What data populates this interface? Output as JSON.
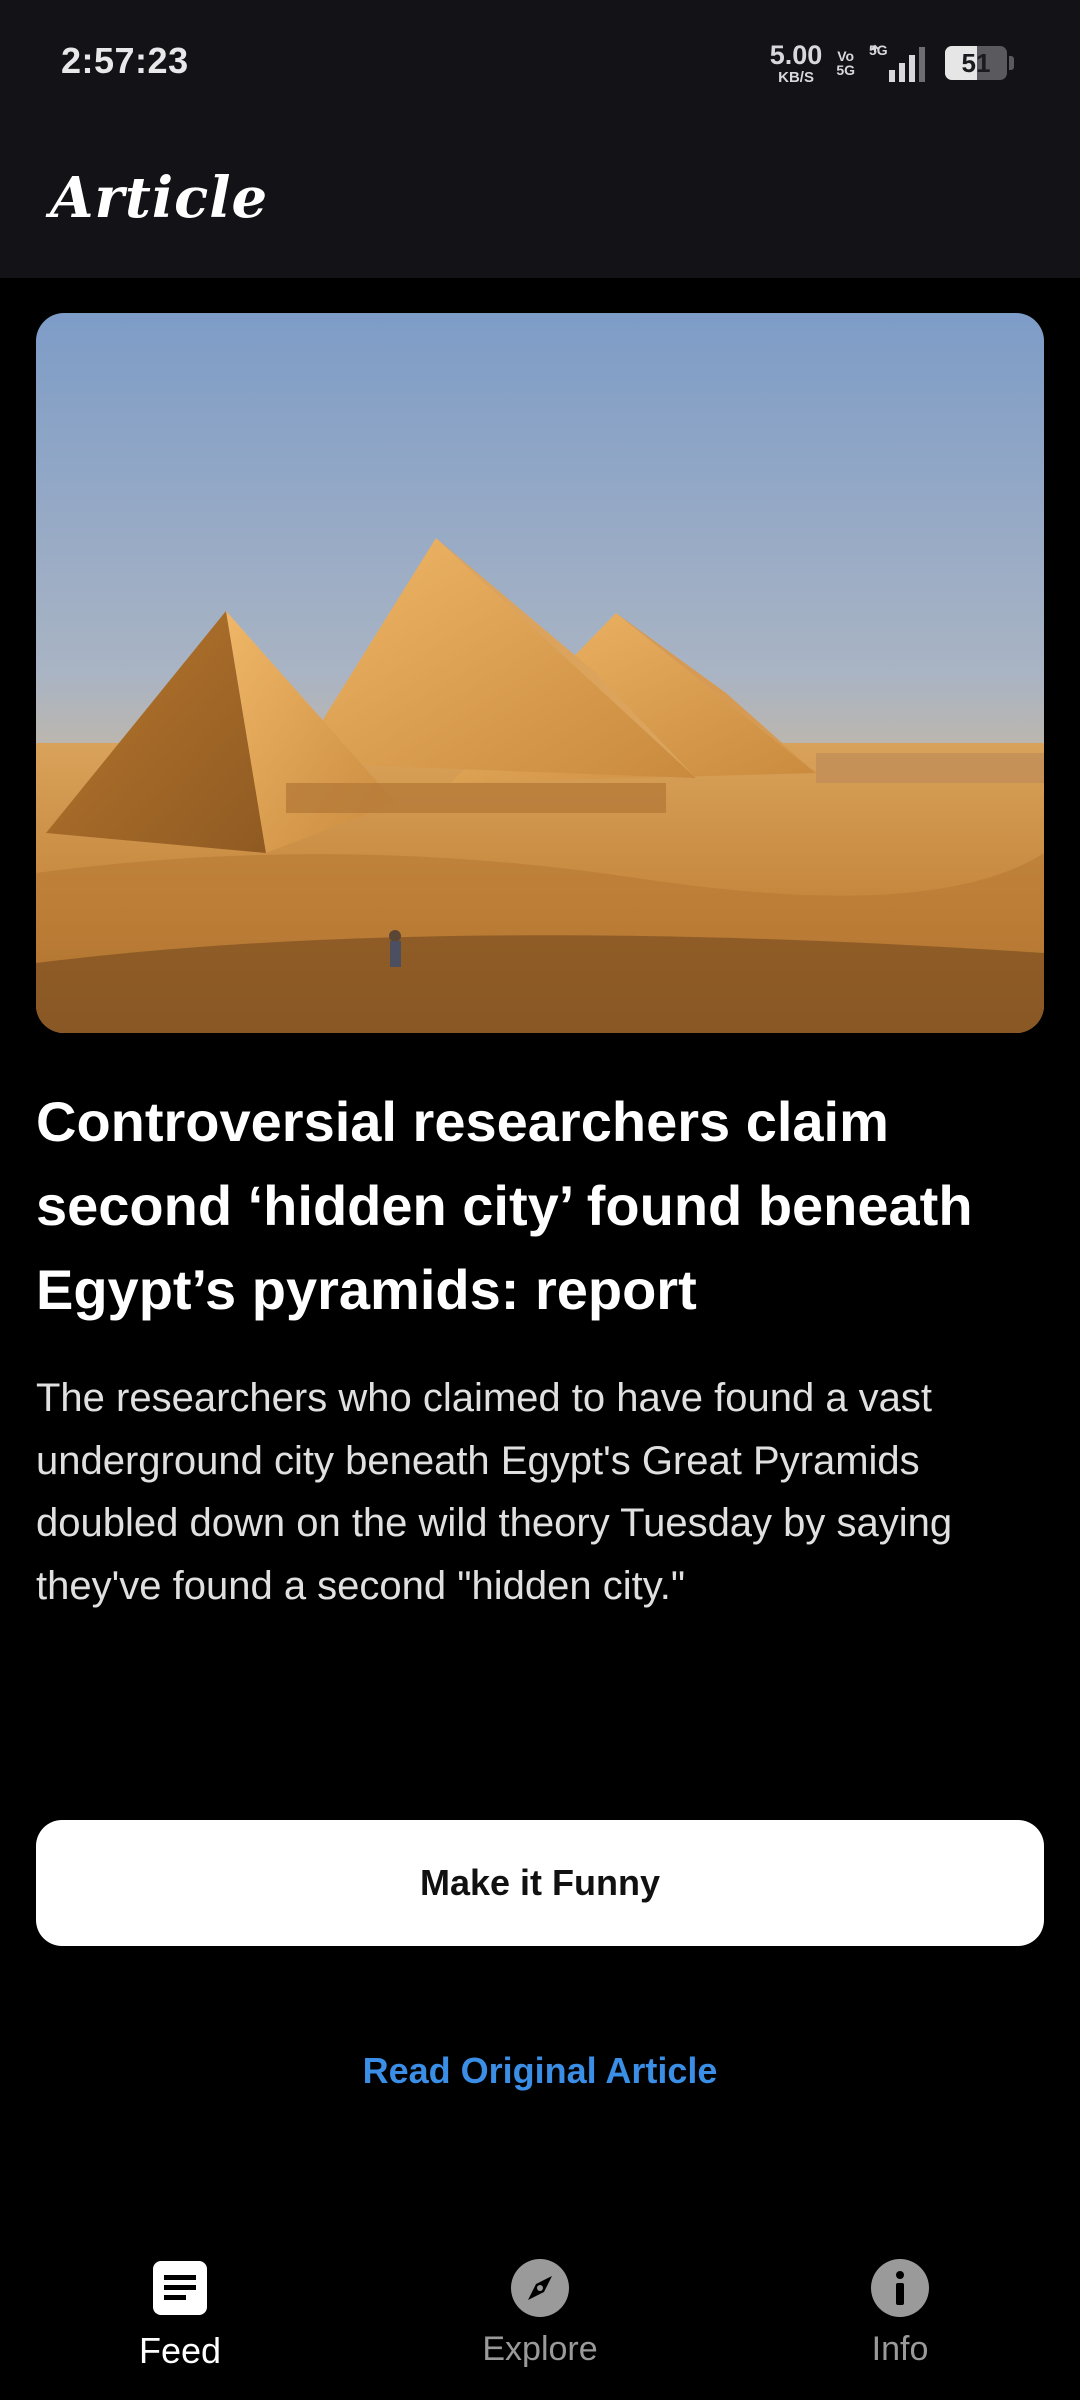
{
  "status_bar": {
    "time": "2:57:23",
    "net_speed_value": "5.00",
    "net_speed_unit": "KB/S",
    "volte_top": "Vo",
    "volte_bottom": "5G",
    "network_label": "5G",
    "battery_level": "51",
    "battery_fraction": 0.51
  },
  "header": {
    "title": "Article"
  },
  "article": {
    "headline": "Controversial researchers claim second ‘hidden city’ found beneath Egypt’s pyramids: report",
    "summary": "The researchers who claimed to have found a vast underground city beneath Egypt's Great Pyramids doubled down on the wild theory Tuesday by saying they've found a second \"hidden city.\""
  },
  "actions": {
    "funny_button_label": "Make it Funny",
    "read_original_label": "Read Original Article"
  },
  "bottom_nav": {
    "items": [
      {
        "label": "Feed",
        "icon": "feed-icon",
        "active": true
      },
      {
        "label": "Explore",
        "icon": "compass-icon",
        "active": false
      },
      {
        "label": "Info",
        "icon": "info-icon",
        "active": false
      }
    ]
  },
  "colors": {
    "background": "#000000",
    "header_bg": "#121217",
    "link": "#3a8ee6",
    "button_bg": "#ffffff",
    "nav_inactive": "#9a9a9a"
  }
}
